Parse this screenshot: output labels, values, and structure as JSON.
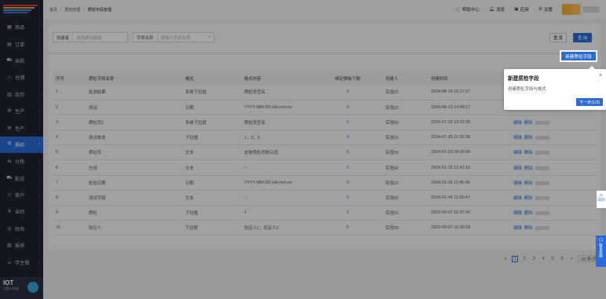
{
  "sidebar": {
    "items": [
      {
        "label": "商品",
        "icon": "grid-icon"
      },
      {
        "label": "订单",
        "icon": "order-icon"
      },
      {
        "label": "采购",
        "icon": "cart-icon"
      },
      {
        "label": "仓储",
        "icon": "warehouse-icon"
      },
      {
        "label": "库存",
        "icon": "inventory-icon"
      },
      {
        "label": "生产",
        "icon": "production-icon"
      },
      {
        "label": "生产",
        "icon": "production2-icon"
      },
      {
        "label": "质检",
        "icon": "shield-icon"
      },
      {
        "label": "分拣",
        "icon": "sort-icon"
      },
      {
        "label": "配送",
        "icon": "truck-icon"
      },
      {
        "label": "客户",
        "icon": "user-icon"
      },
      {
        "label": "业财",
        "icon": "finance-icon"
      },
      {
        "label": "财务",
        "icon": "money-icon"
      },
      {
        "label": "报表",
        "icon": "report-icon"
      },
      {
        "label": "学生餐",
        "icon": "meal-icon"
      }
    ],
    "iot_title": "IOT",
    "iot_sub": "设备与终端"
  },
  "header": {
    "breadcrumb": [
      "首页",
      "质检管理",
      "质检字段管理"
    ],
    "help": "帮助中心",
    "notify": "消息",
    "apps": "应用",
    "settings": "设置"
  },
  "filters": {
    "creator_label": "创建者",
    "creator_placeholder": "请选择创建者",
    "field_label": "字段名称",
    "field_placeholder": "请输入字段名称",
    "reset": "重 置",
    "search": "查 询"
  },
  "toolbar": {
    "new_button": "新建质检字段"
  },
  "table": {
    "headers": [
      "序号",
      "质检字段名称",
      "格式",
      "格式内容",
      "绑定模板个数",
      "创建人",
      "创建时间",
      "操作"
    ],
    "rows": [
      {
        "no": "1",
        "name": "检测结果",
        "format": "系统下拉框",
        "content": "质检员签名",
        "count": "0",
        "creator": "实验02",
        "time": "2024-08-14 10:17:07"
      },
      {
        "no": "2",
        "name": "测试",
        "format": "日期",
        "content": "YYYY-MM-DD HH:mm:ss",
        "count": "0",
        "creator": "实验02",
        "time": "2024-08-13 14:49:17"
      },
      {
        "no": "3",
        "name": "质检员2",
        "format": "系统下拉框",
        "content": "质检员签名",
        "count": "0",
        "creator": "实验02",
        "time": "2024-07-26 19:33:35"
      },
      {
        "no": "4",
        "name": "测试单选",
        "format": "下拉框",
        "content": "1；2；3",
        "count": "0",
        "creator": "实验02",
        "time": "2024-07-25 21:02:28"
      },
      {
        "no": "5",
        "name": "质检员",
        "format": "文本",
        "content": "这是质检员默认值",
        "count": "0",
        "creator": "实验02",
        "time": "2024-07-23 09:00:34"
      },
      {
        "no": "6",
        "name": "左线",
        "format": "文本",
        "content": "--",
        "count": "0",
        "creator": "实验02",
        "time": "2024-01-25 13:41:19"
      },
      {
        "no": "7",
        "name": "检验日期",
        "format": "日期",
        "content": "YYYY-MM-DD HH:mm:ss",
        "count": "0",
        "creator": "实验02",
        "time": "2024-01-06 11:45:45"
      },
      {
        "no": "8",
        "name": "测试字段",
        "format": "文本",
        "content": "--",
        "count": "0",
        "creator": "实验02",
        "time": "2024-01-04 11:09:47"
      },
      {
        "no": "9",
        "name": "质检",
        "format": "下拉框",
        "content": "1",
        "count": "1",
        "creator": "实验02",
        "time": "2023-09-07 16:37:42"
      },
      {
        "no": "10",
        "name": "验证人",
        "format": "下拉框",
        "content": "验证人1；验证人2",
        "count": "0",
        "creator": "实验02",
        "time": "2023-09-07 16:36:18"
      }
    ],
    "op_edit": "编辑",
    "op_delete": "删除"
  },
  "pagination": {
    "prev": "<",
    "pages": [
      "1",
      "2",
      "3",
      "4",
      "5",
      "6"
    ],
    "next": ">",
    "page_size": "10 条/页"
  },
  "guide": {
    "title": "新建质检字段",
    "desc": "创建质检字段与格式",
    "next": "下一步(1/3)",
    "close": "×"
  },
  "float": {
    "side1": "日历",
    "side2": "联系客服"
  },
  "colors": {
    "accent": "#2a6bd6",
    "sidebar_bg": "#1f2330",
    "overlay": "rgba(0,0,0,0.34)"
  }
}
